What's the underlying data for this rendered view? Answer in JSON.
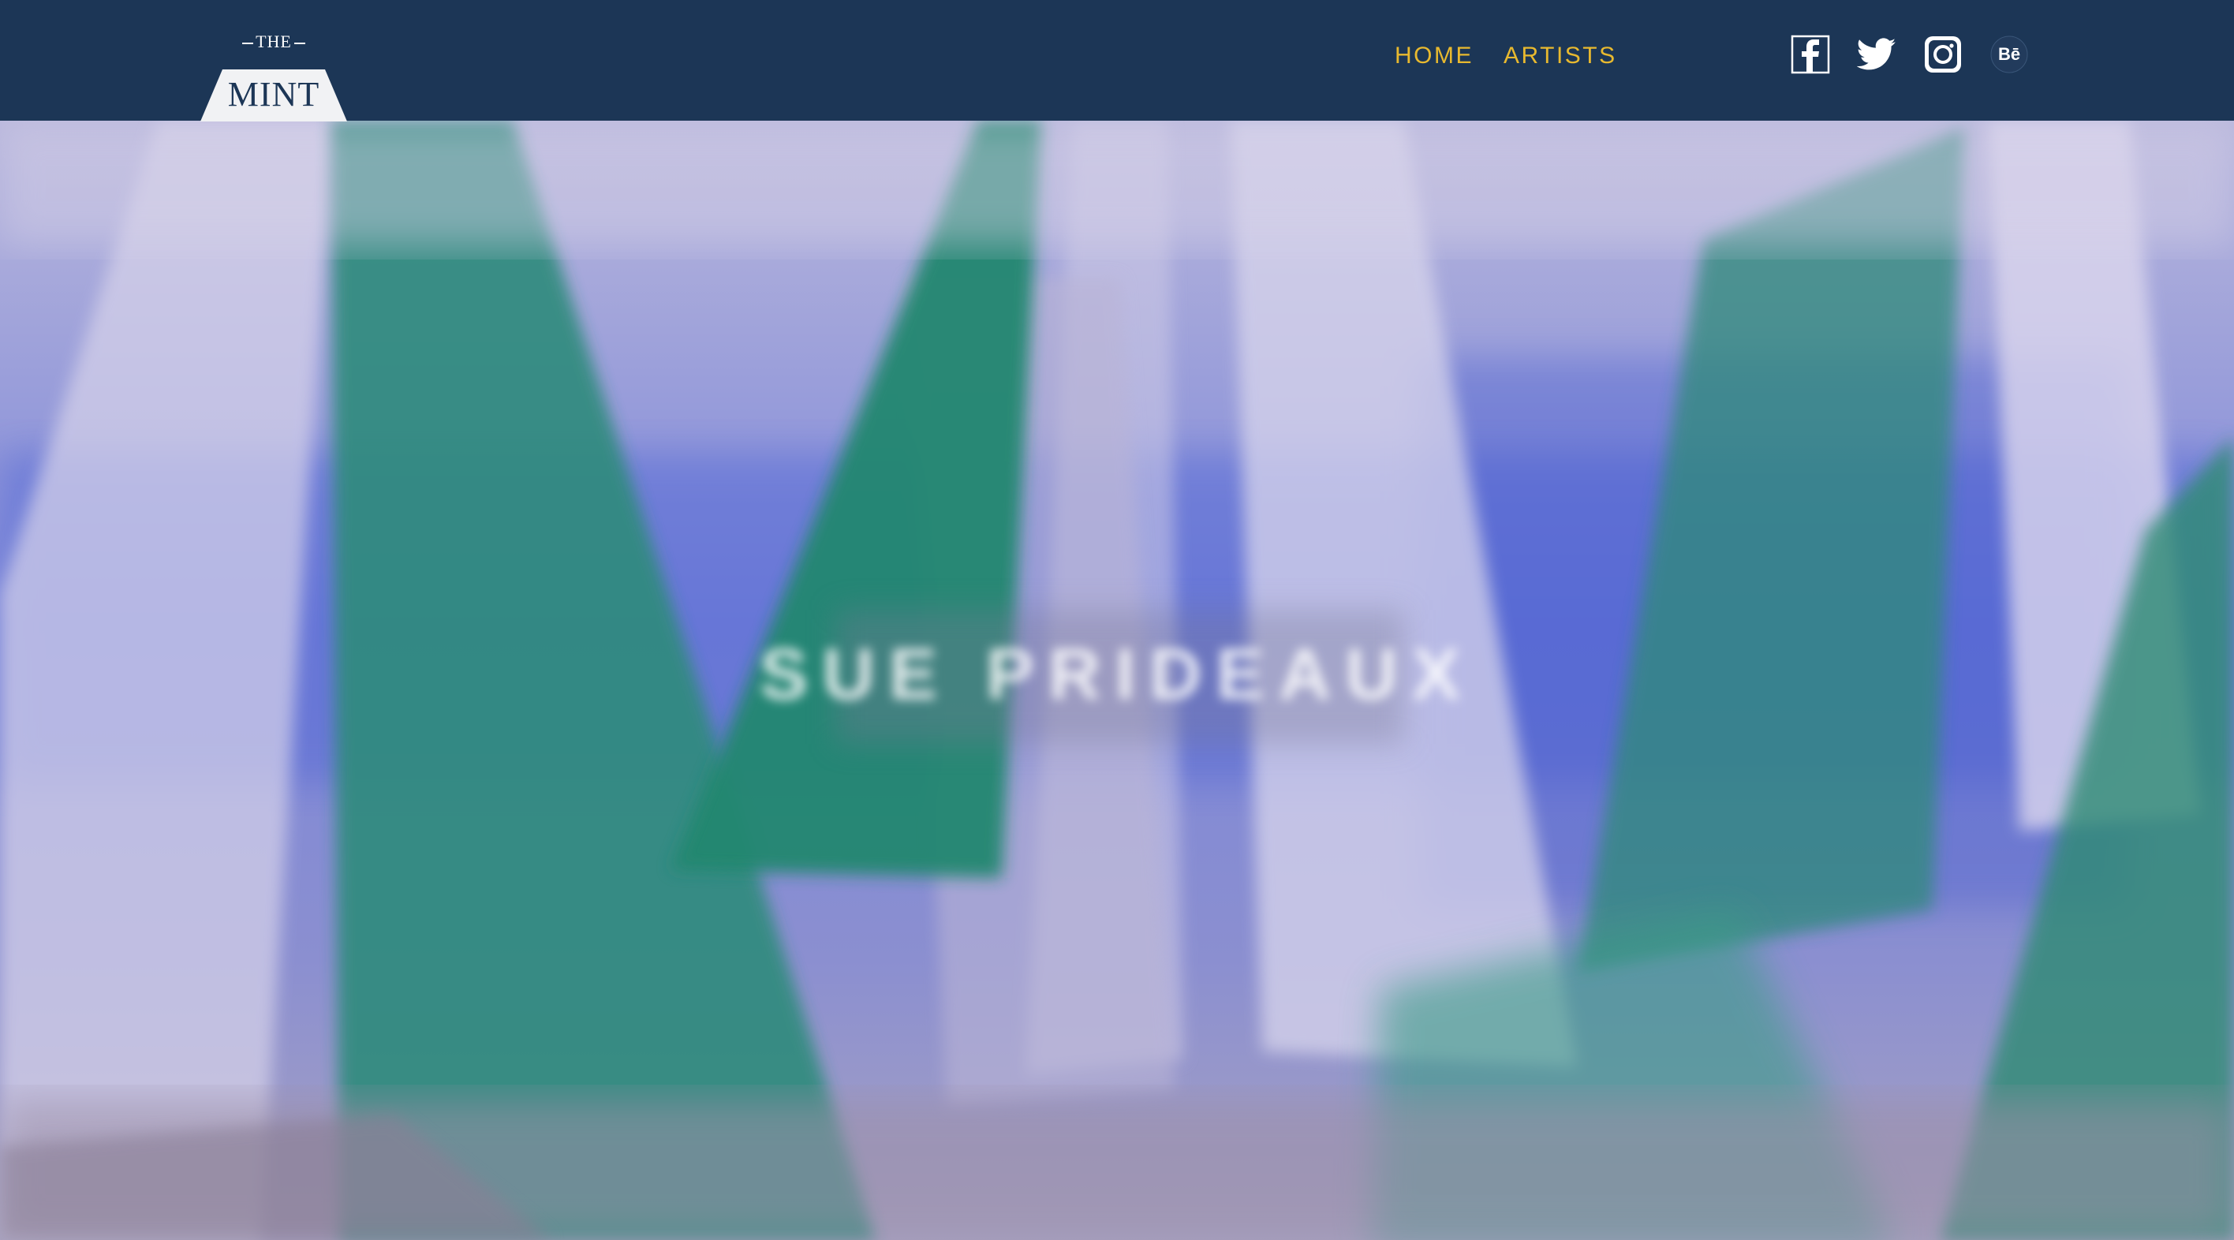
{
  "logo": {
    "top_text": "THE",
    "main_text": "MINT"
  },
  "nav": {
    "items": [
      "HOME",
      "ARTISTS"
    ]
  },
  "social": {
    "icons": [
      "facebook-icon",
      "twitter-icon",
      "instagram-icon",
      "behance-icon"
    ],
    "behance_text": "Bē"
  },
  "hero": {
    "title": "SUE PRIDEAUX"
  },
  "colors": {
    "header_bg": "#1c3656",
    "nav_text": "#e8b92f",
    "logo_bg": "#f1f2f4"
  }
}
